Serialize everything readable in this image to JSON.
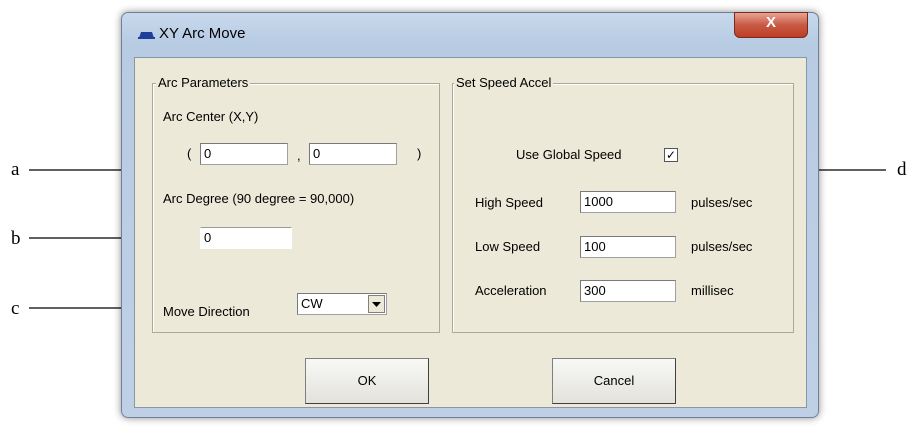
{
  "annotations": [
    "a",
    "b",
    "c",
    "d"
  ],
  "window": {
    "title": "XY Arc Move",
    "close_glyph": "X"
  },
  "arc_parameters": {
    "title": "Arc Parameters",
    "center_label": "Arc Center (X,Y)",
    "open_paren": "(",
    "close_paren": ")",
    "separator": ",",
    "center_x": "0",
    "center_y": "0",
    "degree_label": "Arc Degree (90 degree = 90,000)",
    "degree_value": "0",
    "direction_label": "Move Direction",
    "direction_value": "CW"
  },
  "speed": {
    "title": "Set Speed Accel",
    "use_global_label": "Use Global Speed",
    "use_global_checked": true,
    "check_glyph": "✓",
    "high_label": "High Speed",
    "high_value": "1000",
    "high_unit": "pulses/sec",
    "low_label": "Low Speed",
    "low_value": "100",
    "low_unit": "pulses/sec",
    "accel_label": "Acceleration",
    "accel_value": "300",
    "accel_unit": "millisec"
  },
  "buttons": {
    "ok": "OK",
    "cancel": "Cancel"
  },
  "icons": [
    "app-icon",
    "close-icon",
    "chevron-down-icon",
    "checkmark-icon",
    "arrow-icon"
  ],
  "colors": {
    "close_button": "#c75a44",
    "title_bar": "#c9d9ec",
    "dialog_face": "#ece9d8",
    "app_icon": "#1f3f9a"
  }
}
